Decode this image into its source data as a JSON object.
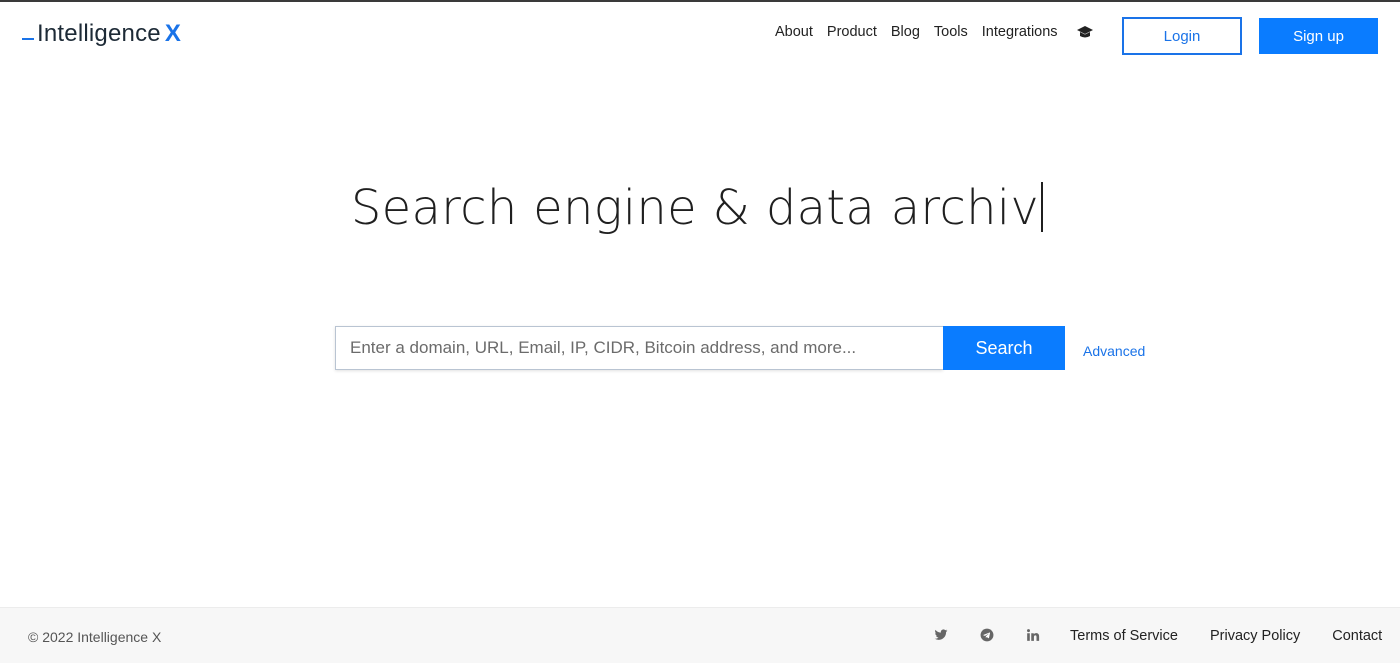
{
  "brand": {
    "name_part1": "Intelligence",
    "name_part2": "X",
    "accent_color": "#1a73e8"
  },
  "nav": {
    "items": [
      {
        "label": "About"
      },
      {
        "label": "Product"
      },
      {
        "label": "Blog"
      },
      {
        "label": "Tools"
      },
      {
        "label": "Integrations"
      }
    ],
    "extra_icon": "graduation-cap-icon",
    "login_label": "Login",
    "signup_label": "Sign up"
  },
  "hero": {
    "title": "Search engine & data archiv"
  },
  "search": {
    "placeholder": "Enter a domain, URL, Email, IP, CIDR, Bitcoin address, and more...",
    "value": "",
    "button_label": "Search",
    "advanced_label": "Advanced"
  },
  "footer": {
    "copyright": "© 2022 Intelligence X",
    "social_icons": [
      "twitter-icon",
      "telegram-icon",
      "linkedin-icon"
    ],
    "links": [
      {
        "label": "Terms of Service"
      },
      {
        "label": "Privacy Policy"
      },
      {
        "label": "Contact"
      }
    ]
  }
}
